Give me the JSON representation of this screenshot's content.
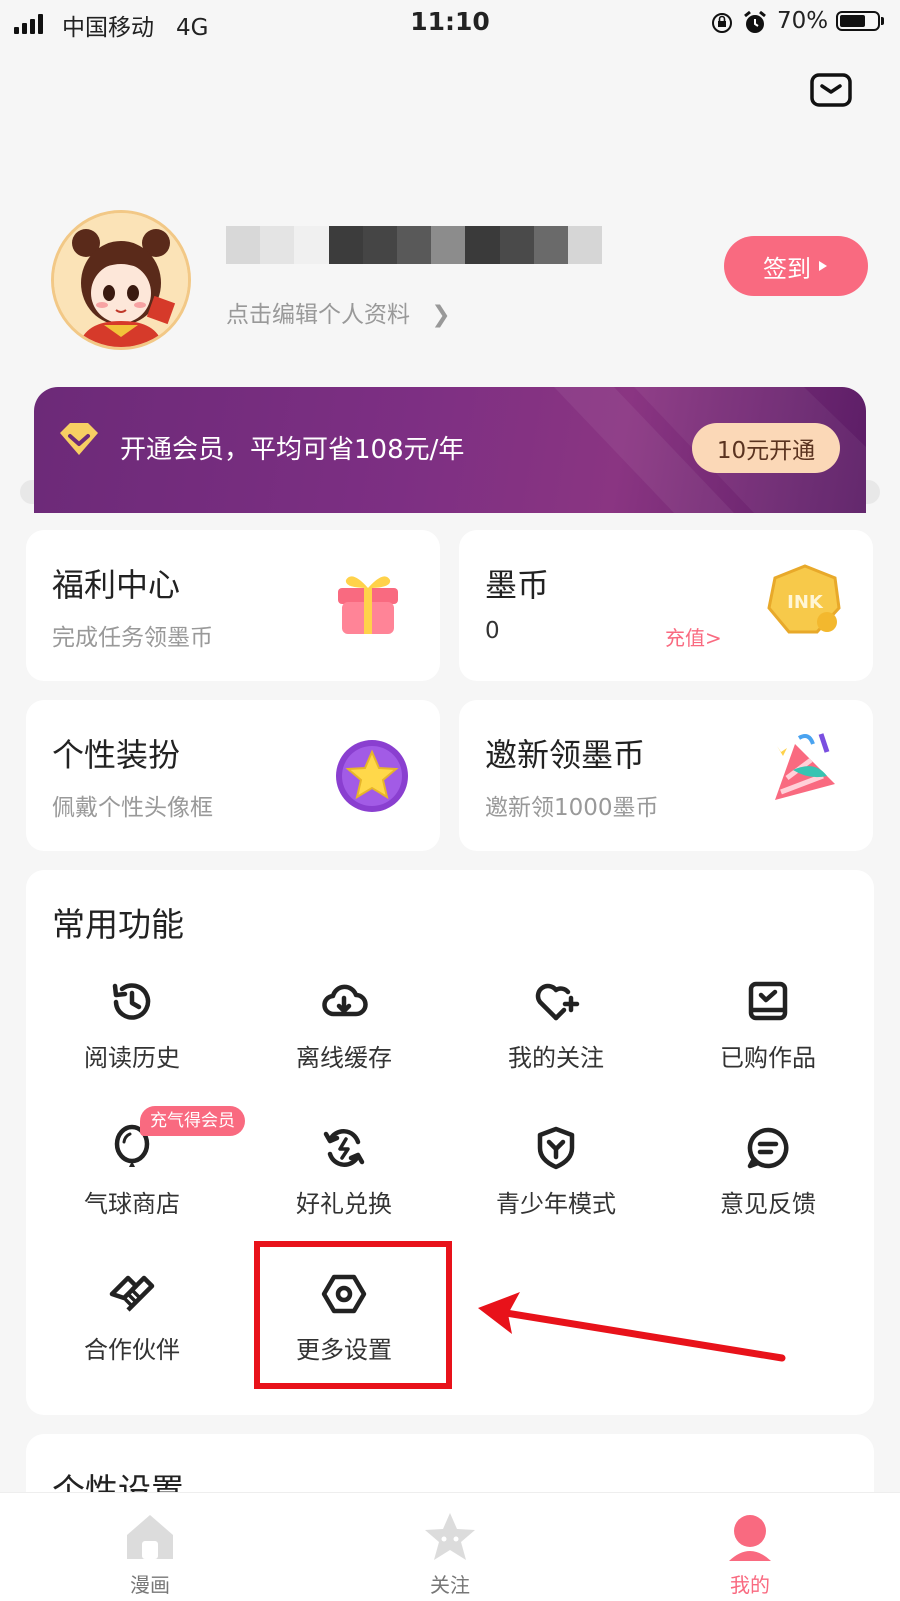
{
  "status_bar": {
    "carrier": "中国移动",
    "network": "4G",
    "time": "11:10",
    "battery": "70%",
    "battery_level": 0.7
  },
  "profile": {
    "edit_text": "点击编辑个人资料",
    "checkin_label": "签到"
  },
  "vip": {
    "text": "开通会员，平均可省108元/年",
    "button": "10元开通"
  },
  "cards": [
    {
      "title": "福利中心",
      "subtitle": "完成任务领墨币",
      "icon": "gift-icon"
    },
    {
      "title": "墨币",
      "value": "0",
      "action": "充值>",
      "icon": "ink-coin-icon"
    },
    {
      "title": "个性装扮",
      "subtitle": "佩戴个性头像框",
      "icon": "star-icon"
    },
    {
      "title": "邀新领墨币",
      "subtitle": "邀新领1000墨币",
      "icon": "party-popper-icon"
    }
  ],
  "common_functions": {
    "title": "常用功能",
    "items": [
      {
        "label": "阅读历史",
        "icon": "history-icon"
      },
      {
        "label": "离线缓存",
        "icon": "cloud-download-icon"
      },
      {
        "label": "我的关注",
        "icon": "heart-plus-icon"
      },
      {
        "label": "已购作品",
        "icon": "purchased-book-icon"
      },
      {
        "label": "气球商店",
        "icon": "balloon-icon"
      },
      {
        "label": "好礼兑换",
        "icon": "exchange-icon"
      },
      {
        "label": "青少年模式",
        "icon": "shield-icon"
      },
      {
        "label": "意见反馈",
        "icon": "feedback-icon"
      },
      {
        "label": "合作伙伴",
        "icon": "handshake-icon"
      },
      {
        "label": "更多设置",
        "icon": "settings-icon"
      }
    ],
    "balloon_badge": "充气得会员"
  },
  "personal_settings": {
    "title": "个性设置"
  },
  "tabbar": {
    "tabs": [
      {
        "label": "漫画",
        "icon": "home-icon"
      },
      {
        "label": "关注",
        "icon": "star-face-icon"
      },
      {
        "label": "我的",
        "icon": "profile-icon",
        "active": true
      }
    ]
  },
  "colors": {
    "accent": "#f96a80",
    "vip_purple": "#6c2a78",
    "highlight_red": "#e8121a"
  }
}
